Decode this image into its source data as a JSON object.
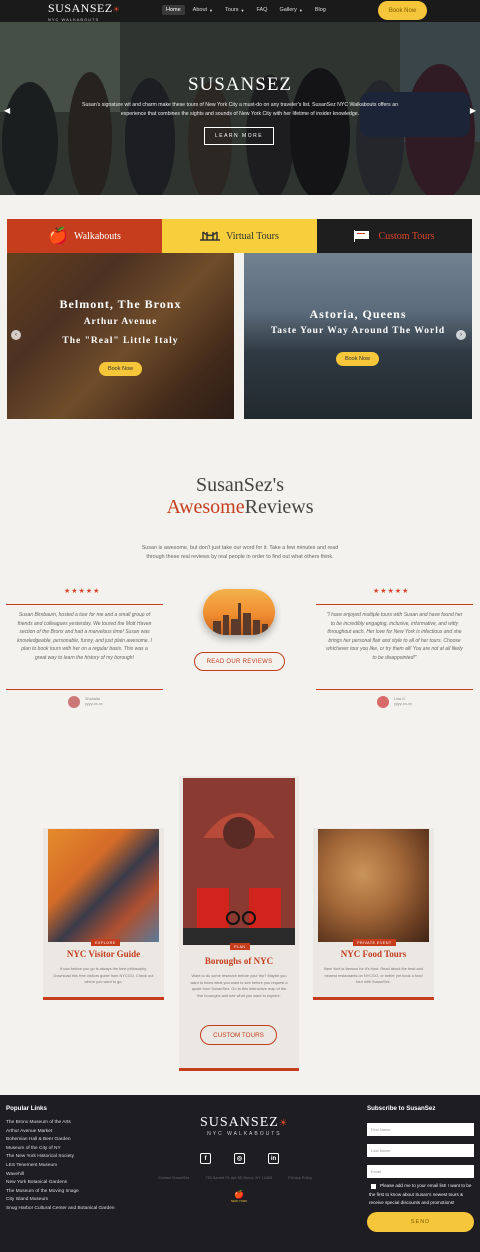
{
  "nav": {
    "logo": "SUSANSEZ",
    "logo_sub": "NYC WALKABOUTS",
    "items": [
      {
        "label": "Home",
        "caret": false
      },
      {
        "label": "About",
        "caret": true
      },
      {
        "label": "Tours",
        "caret": true
      },
      {
        "label": "FAQ",
        "caret": false
      },
      {
        "label": "Gallery",
        "caret": true
      },
      {
        "label": "Blog",
        "caret": false
      }
    ],
    "book": "Book Now"
  },
  "hero": {
    "title": "SUSANSEZ",
    "text": "Susan's signature wit and charm make these tours of New York City a must-do on any traveler's list. SusanSez NYC Walkabouts offers an experience that combines the sights and sounds of New York City with her lifetime of insider knowledge.",
    "button": "LEARN MORE"
  },
  "tabs": [
    {
      "label": "Walkabouts",
      "icon": "apple-icon"
    },
    {
      "label": "Virtual Tours",
      "icon": "bridge-icon"
    },
    {
      "label": "Custom Tours",
      "icon": "flag-icon"
    }
  ],
  "tours": [
    {
      "line1": "Belmont, The Bronx",
      "line2": "Arthur Avenue",
      "line3": "The \"Real\" Little Italy",
      "button": "Book Now"
    },
    {
      "line1": "Astoria, Queens",
      "line2": "Taste Your Way Around The World",
      "button": "Book Now"
    }
  ],
  "reviews": {
    "title_line1": "SusanSez's",
    "title_accent": "Awesome",
    "title_rest": "Reviews",
    "intro": "Susan is awesome, but don't just take our word for it. Take a few minutes and read through these real reviews by real people in order to find out what others think.",
    "stars": "★★★★★",
    "quote1": "Susan Birnbaum, hosted a tour for me and a small group of friends and colleagues yesterday. We toured the Mott Haven section of the Bronx and had a marvelous time! Susan was knowledgeable, personable, funny, and just plain awesome. I plan to book tours with her on a regular basis. This was a great way to learn the history of my borough!",
    "reviewer1": "Shahalla",
    "reviewer1_date": "yyyy-xx-xx",
    "quote2": "\"I have enjoyed multiple tours with Susan and have found her to be incredibly engaging, inclusive, informative, and witty throughout each. Her love for New York is infectious and she brings her personal flair and style to all of her tours. Choose whichever tour you like, or try them all! You are not at all likely to be disappointed!\"",
    "reviewer2": "Lisa G.",
    "reviewer2_date": "yyyy-xx-xx",
    "button": "READ OUR REVIEWS"
  },
  "guides": [
    {
      "tag": "EXPLORE",
      "title": "NYC Visitor Guide",
      "text": "Know before you go is always the best philosophy. Download this free visitors guide from NYCGO. Check out where you want to go."
    },
    {
      "tag": "PLAN",
      "title": "Boroughs of NYC",
      "text": "Want to do some research before your trip? Maybe you want to know what you want to see before you request a quote from SusanSez. Go to this interactive map of the five boroughs and see what you want to explore."
    },
    {
      "tag": "PRIVATE EVENT",
      "title": "NYC Food Tours",
      "text": "New York is famous for it's food. Read about the best and newest restaurants on NYCGO, or better yet book a food tour with SusanSez."
    }
  ],
  "custom_button": "CUSTOM TOURS",
  "footer": {
    "links_title": "Popular Links",
    "links": [
      "The Bronx Museum of the Arts",
      "Arthur Avenue Market",
      "Bohemian Hall & Beer Garden",
      "Museum of the City of NY",
      "The New York Historical Society",
      "LES Tenement Museum",
      "Wavehill",
      "New York Botanical Gardens",
      "The Museum of the Moving Image",
      "City Island Museum",
      "Snug Harbor Cultural Center and Botanical Garden"
    ],
    "logo": "SUSANSEZ",
    "logo_sub": "NYC WALKABOUTS",
    "small": [
      "Contact SusanSez",
      "755 Barrett St. Apt 3D Bronx, NY 10455",
      "Privacy Policy"
    ],
    "badge_top": "NEW YORK",
    "badge_sub": "NEW YORK",
    "subscribe_title": "Subscribe to SusanSez",
    "first_placeholder": "First Name",
    "last_placeholder": "Last Name",
    "email_placeholder": "Email",
    "consent": "Please add me to your email list! I want to be the first to know about Susan's newest tours & receive special discounts and promotions!",
    "send": "SEND"
  }
}
